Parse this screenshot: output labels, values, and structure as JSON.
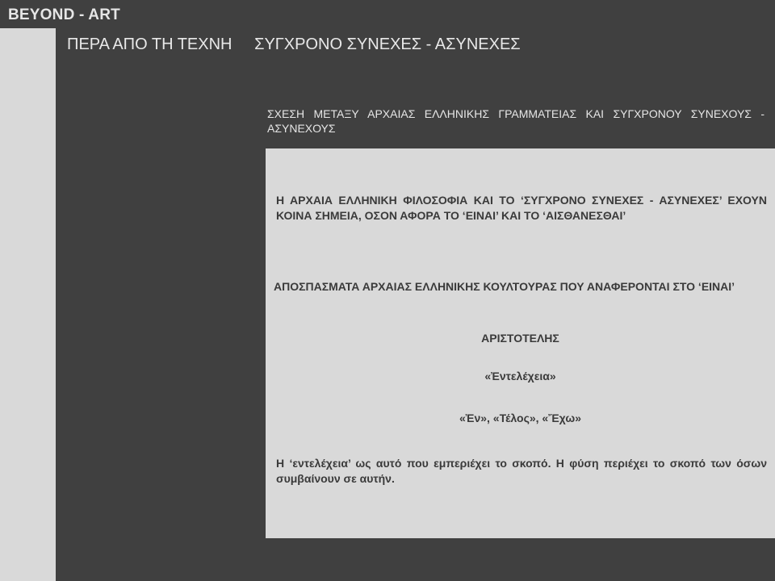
{
  "site": {
    "title": "BEYOND - ART"
  },
  "nav": {
    "items": [
      {
        "label": "ΠΕΡΑ ΑΠΟ ΤΗ ΤΕΧΝΗ"
      },
      {
        "label": "ΣΥΓΧΡΟΝΟ ΣΥΝΕΧΕΣ - ΑΣΥΝΕΧΕΣ"
      }
    ]
  },
  "section": {
    "heading": "ΣΧΕΣΗ ΜΕΤΑΞΥ ΑΡΧΑΙΑΣ ΕΛΛΗΝΙΚΗΣ ΓΡΑΜΜΑΤΕΙΑΣ ΚΑΙ ΣΥΓΧΡΟΝΟΥ ΣΥΝΕΧΟΥΣ - ΑΣΥΝΕΧΟΥΣ"
  },
  "content": {
    "intro": "Η ΑΡΧΑΙΑ ΕΛΛΗΝΙΚΗ ΦΙΛΟΣΟΦΙΑ ΚΑΙ ΤΟ ‘ΣΥΓΧΡΟΝΟ ΣΥΝΕΧΕΣ - ΑΣΥΝΕΧΕΣ’ ΕΧΟΥΝ ΚΟΙΝΑ ΣΗΜΕΙΑ, ΟΣΟΝ ΑΦΟΡΑ ΤΟ ‘ΕΙΝΑΙ’ ΚΑΙ ΤΟ ‘ΑΙΣΘΑΝΕΣΘΑΙ’",
    "excerpts_heading": "ΑΠΟΣΠΑΣΜΑΤΑ ΑΡΧΑΙΑΣ ΕΛΛΗΝΙΚΗΣ ΚΟΥΛΤΟΥΡΑΣ ΠΟΥ ΑΝΑΦΕΡΟΝΤΑΙ ΣΤΟ ‘ΕΙΝΑΙ’",
    "author": "ΑΡΙΣΤΟΤΕΛΗΣ",
    "term": "«Ἐντελέχεια»",
    "terms": "«Ἐν», «Τέλος», «Ἔχω»",
    "closing": "Η ‘εντελέχεια’ ως αυτό που εμπεριέχει το σκοπό. Η φύση περιέχει το σκοπό των όσων συμβαίνουν σε αυτήν."
  },
  "colors": {
    "background": "#404040",
    "panel": "#d9d9d9",
    "light_text": "#e6e6e6",
    "dark_text": "#3a3a3a"
  }
}
